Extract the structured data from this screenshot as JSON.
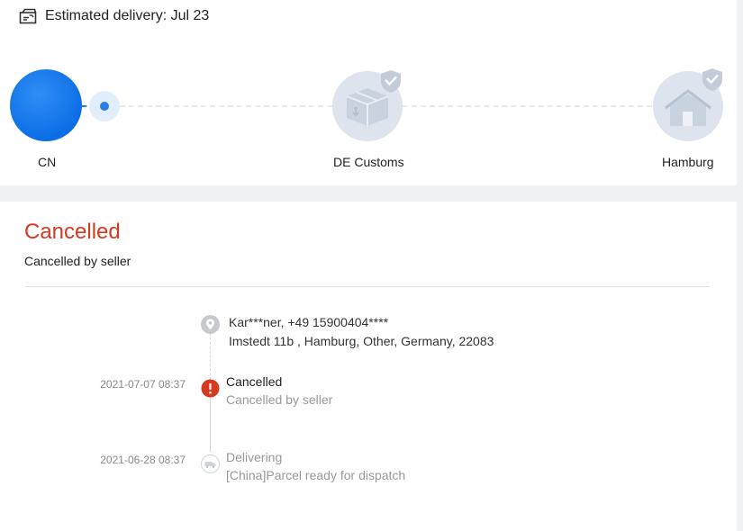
{
  "delivery": {
    "estimated_label": "Estimated delivery: Jul 23",
    "icon": "delivery-box-icon"
  },
  "route": {
    "stops": [
      {
        "label": "CN",
        "state": "current"
      },
      {
        "label": "DE Customs",
        "icon": "customs-package-icon"
      },
      {
        "label": "Hamburg",
        "icon": "house-icon"
      }
    ]
  },
  "status": {
    "title": "Cancelled",
    "subtitle": "Cancelled by seller"
  },
  "address": {
    "line1": "Kar***ner,  +49 15900404****",
    "line2": "Imstedt 11b ,  Hamburg,  Other,  Germany,  22083"
  },
  "timeline": [
    {
      "date": "2021-07-07 08:37",
      "title": "Cancelled",
      "detail": "Cancelled by seller",
      "icon": "exclamation-icon"
    },
    {
      "date": "2021-06-28 08:37",
      "title": "Delivering",
      "detail": "[China]Parcel ready for dispatch",
      "icon": "truck-icon"
    }
  ],
  "colors": {
    "accent": "#2a7de1",
    "cancelled": "#d6391e",
    "background": "#f0f1f3"
  }
}
